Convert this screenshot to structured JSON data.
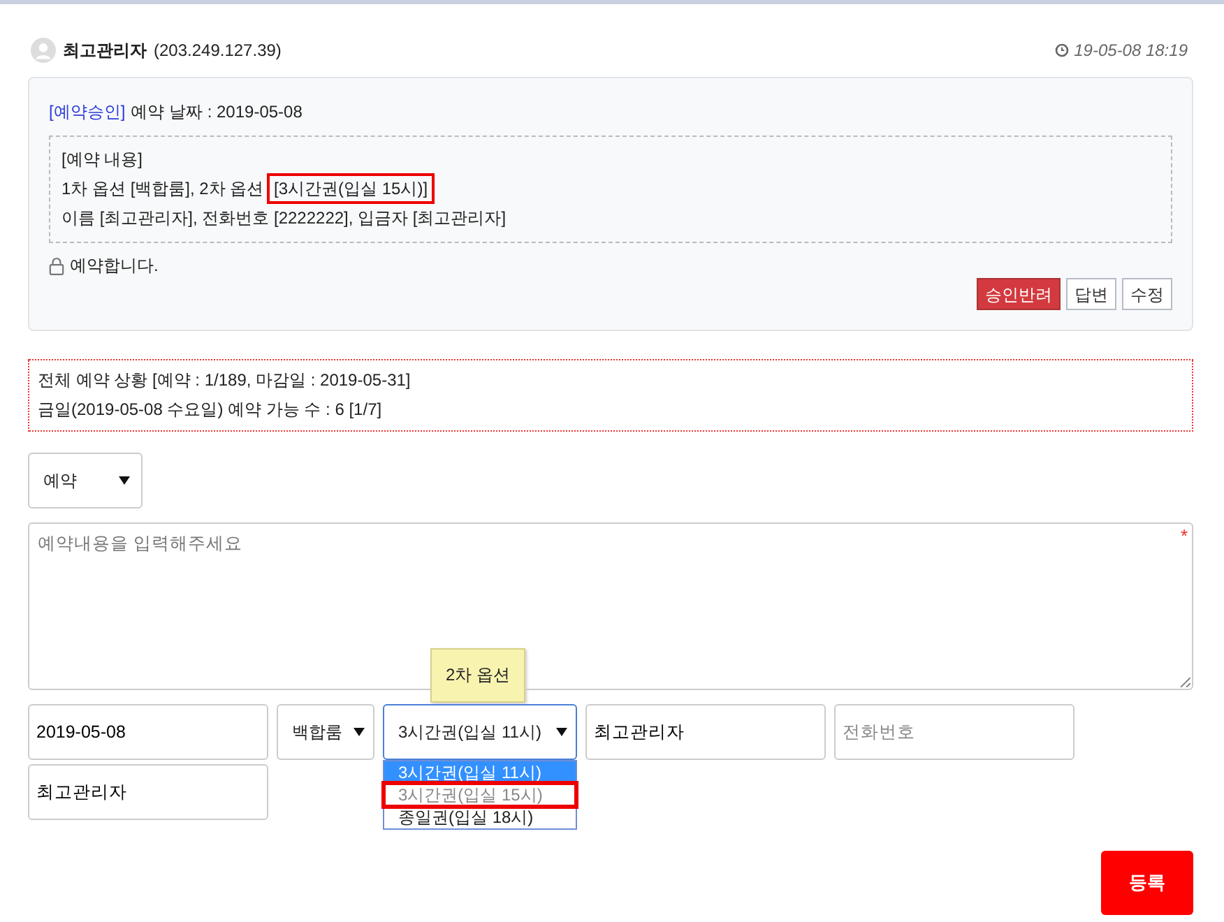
{
  "post": {
    "author": "최고관리자",
    "ip": "(203.249.127.39)",
    "timestamp": "19-05-08 18:19",
    "status_label": "[예약승인]",
    "date_label": "예약 날짜 : 2019-05-08",
    "details": [
      {
        "text": "[예약 내용]"
      },
      {
        "text": "1차 옵션 [백합룸], 2차 옵션 ",
        "highlight": "[3시간권(입실 15시)]"
      },
      {
        "text": "이름 [최고관리자], 전화번호 [2222222], 입금자 [최고관리자]"
      }
    ],
    "lock_note": "예약합니다.",
    "buttons": [
      {
        "label": "승인반려",
        "kind": "danger"
      },
      {
        "label": "답변",
        "kind": "plain"
      },
      {
        "label": "수정",
        "kind": "plain"
      }
    ]
  },
  "summary": [
    "전체 예약 상황 [예약 : 1/189, 마감일 : 2019-05-31]",
    "금일(2019-05-08 수요일) 예약 가능 수 : 6 [1/7]"
  ],
  "form": {
    "type_select": "예약",
    "content": {
      "placeholder": "예약내용을 입력해주세요",
      "required_mark": "*"
    },
    "tooltip": "2차 옵션",
    "fields": [
      {
        "kind": "input",
        "value": "2019-05-08"
      },
      {
        "kind": "select",
        "value": "백합룸",
        "open": false
      },
      {
        "kind": "select",
        "value": "3시간권(입실 11시)",
        "open": true
      },
      {
        "kind": "input",
        "value": "최고관리자"
      },
      {
        "kind": "input",
        "placeholder": "전화번호"
      },
      {
        "kind": "input",
        "value": "최고관리자"
      }
    ],
    "options": [
      {
        "label": "3시간권(입실 11시)",
        "selected": true,
        "disabled": false,
        "highlighted": false
      },
      {
        "label": "3시간권(입실 15시)",
        "selected": false,
        "disabled": true,
        "highlighted": true
      },
      {
        "label": "종일권(입실 18시)",
        "selected": false,
        "disabled": false,
        "highlighted": false
      }
    ],
    "submit": "등록"
  }
}
